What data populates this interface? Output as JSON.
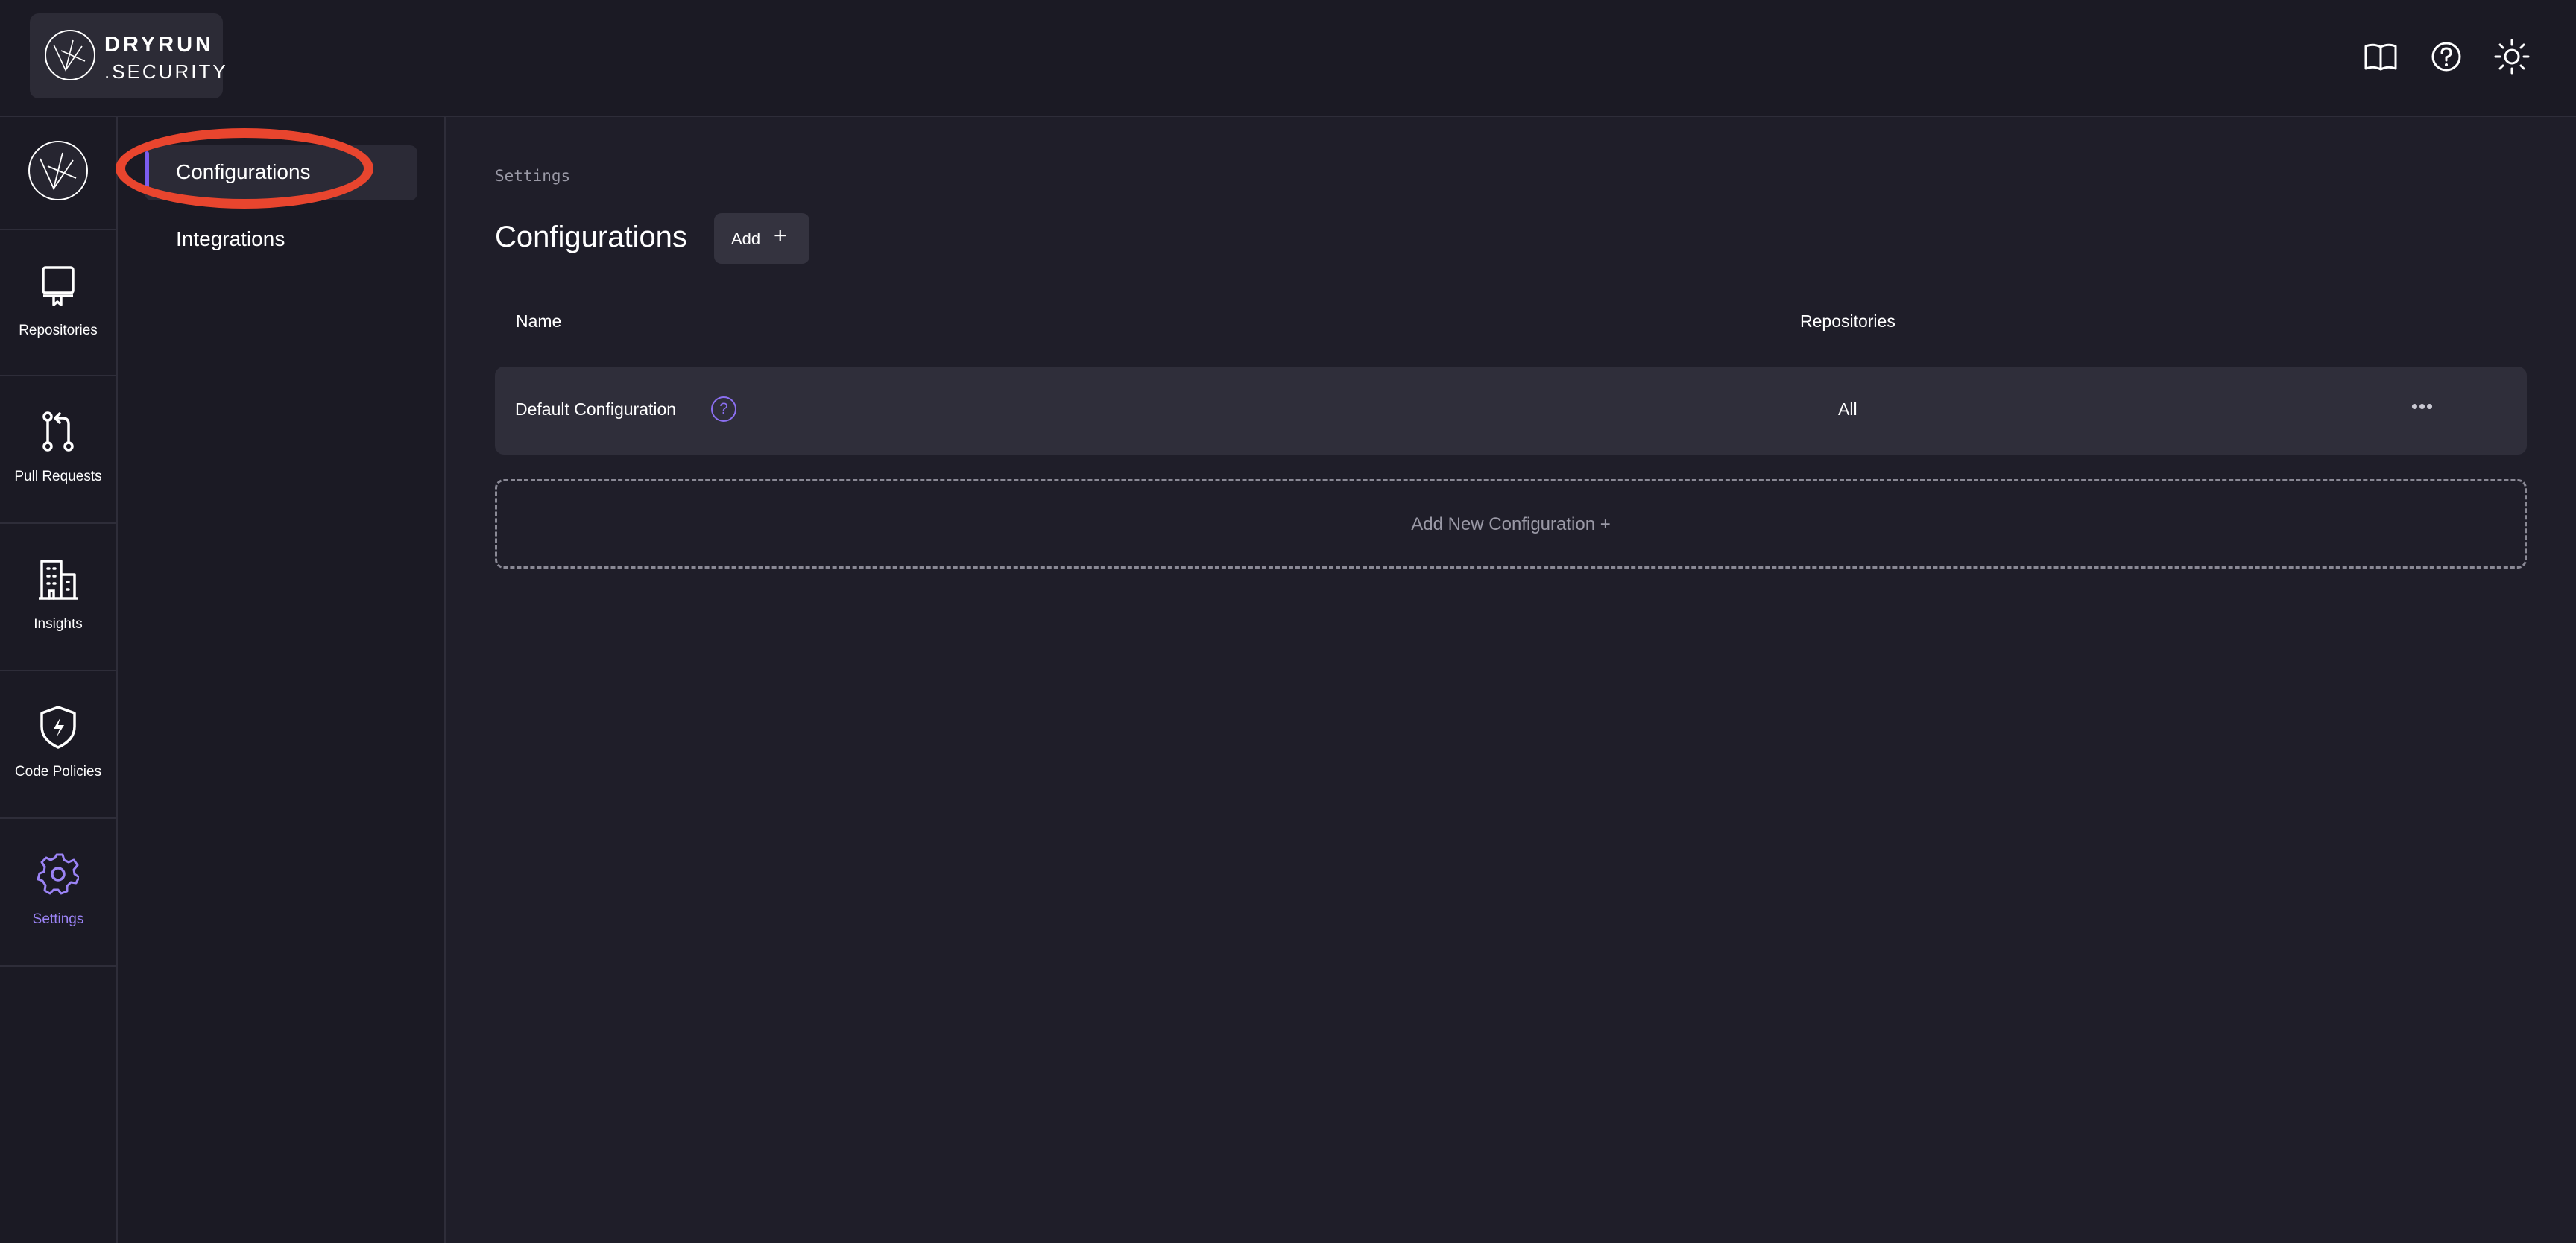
{
  "brand": {
    "line1": "DRYRUN",
    "line2": ".SECURITY"
  },
  "header": {
    "icons": [
      "book-icon",
      "help-circle-icon",
      "sun-icon"
    ]
  },
  "rail": {
    "items": [
      {
        "label": "Repositories",
        "icon": "repository-icon"
      },
      {
        "label": "Pull Requests",
        "icon": "pull-request-icon"
      },
      {
        "label": "Insights",
        "icon": "building-icon"
      },
      {
        "label": "Code Policies",
        "icon": "shield-bolt-icon"
      },
      {
        "label": "Settings",
        "icon": "gear-icon",
        "active": true
      }
    ]
  },
  "subnav": {
    "items": [
      {
        "label": "Configurations",
        "active": true
      },
      {
        "label": "Integrations"
      }
    ]
  },
  "main": {
    "breadcrumb": "Settings",
    "title": "Configurations",
    "add_label": "Add",
    "add_icon": "+",
    "columns": {
      "name": "Name",
      "repositories": "Repositories"
    },
    "rows": [
      {
        "name": "Default Configuration",
        "help": "?",
        "repositories": "All",
        "more": "•••"
      }
    ],
    "add_new_label": "Add New Configuration +"
  },
  "colors": {
    "accent": "#7b5cf0",
    "annotation": "#e8452e",
    "background": "#1f1e29"
  }
}
